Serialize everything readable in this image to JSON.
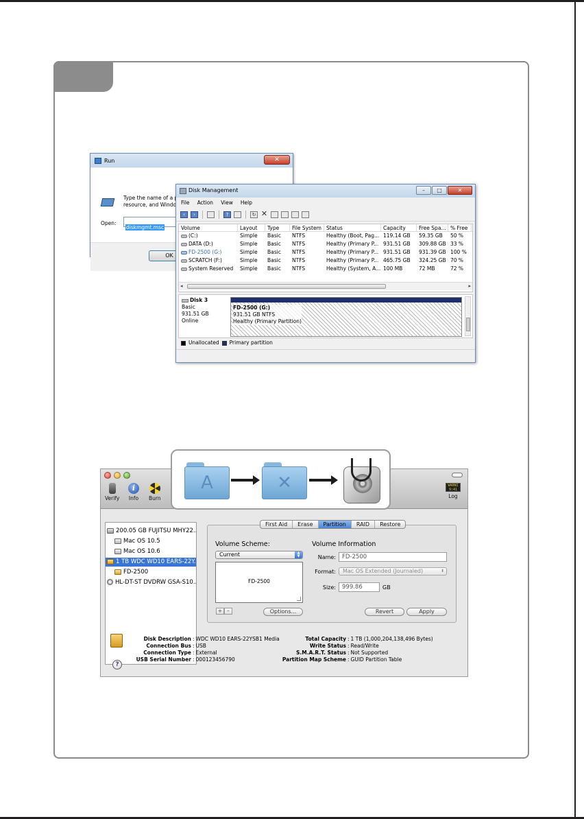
{
  "run_dialog": {
    "title": "Run",
    "description": "Type the name of a program, folder, document, or Internet resource, and Windows will open it for you.",
    "open_label": "Open:",
    "open_value": "diskmgmt.msc",
    "ok_label": "OK",
    "close_glyph": "✕"
  },
  "disk_management": {
    "title": "Disk Management",
    "window_buttons": {
      "minimize": "–",
      "maximize": "□",
      "close": "✕"
    },
    "menu": [
      "File",
      "Action",
      "View",
      "Help"
    ],
    "toolbar_icons": [
      "back-arrow-icon",
      "forward-arrow-icon",
      "console-tree-icon",
      "help-icon",
      "properties-icon",
      "refresh-icon",
      "delete-icon",
      "open-icon",
      "explore-icon",
      "search-icon",
      "settings-icon"
    ],
    "columns": [
      "Volume",
      "Layout",
      "Type",
      "File System",
      "Status",
      "Capacity",
      "Free Spa...",
      "% Free"
    ],
    "rows": [
      [
        "(C:)",
        "Simple",
        "Basic",
        "NTFS",
        "Healthy (Boot, Pag...",
        "119.14 GB",
        "59.35 GB",
        "50 %"
      ],
      [
        "DATA (D:)",
        "Simple",
        "Basic",
        "NTFS",
        "Healthy (Primary P...",
        "931.51 GB",
        "309.88 GB",
        "33 %"
      ],
      [
        "FD-2500 (G:)",
        "Simple",
        "Basic",
        "NTFS",
        "Healthy (Primary P...",
        "931.51 GB",
        "931.39 GB",
        "100 %"
      ],
      [
        "SCRATCH (F:)",
        "Simple",
        "Basic",
        "NTFS",
        "Healthy (Primary P...",
        "465.75 GB",
        "324.25 GB",
        "70 %"
      ],
      [
        "System Reserved",
        "Simple",
        "Basic",
        "NTFS",
        "Healthy (System, A...",
        "100 MB",
        "72 MB",
        "72 %"
      ]
    ],
    "disk": {
      "name": "Disk 3",
      "type": "Basic",
      "size": "931.51 GB",
      "state": "Online",
      "partition_name": "FD-2500  (G:)",
      "partition_size": "931.51 GB NTFS",
      "partition_status": "Healthy (Primary Partition)"
    },
    "legend": {
      "unallocated": "Unallocated",
      "primary": "Primary partition",
      "unallocated_color": "#000000",
      "primary_color": "#1f2f6b"
    }
  },
  "disk_utility": {
    "toolbar": {
      "verify": "Verify",
      "info": "Info",
      "burn": "Burn",
      "log": "Log",
      "info_glyph": "i",
      "log_glyph": "WARNI 9:41"
    },
    "sidebar": [
      "200.05 GB FUJITSU MHY22...",
      "Mac OS 10.5",
      "Mac OS 10.6",
      "1 TB WDC WD10 EARS-22Y...",
      "FD-2500",
      "HL-DT-ST DVDRW GSA-S10..."
    ],
    "tabs": [
      "First Aid",
      "Erase",
      "Partition",
      "RAID",
      "Restore"
    ],
    "active_tab": "Partition",
    "volume_scheme_label": "Volume Scheme:",
    "volume_scheme_value": "Current",
    "partition_box_label": "FD-2500",
    "add_glyph": "+",
    "remove_glyph": "–",
    "options_label": "Options...",
    "volume_info_label": "Volume Information",
    "name_label": "Name:",
    "name_value": "FD-2500",
    "format_label": "Format:",
    "format_value": "Mac OS Extended (Journaled)",
    "size_label": "Size:",
    "size_value": "999.86",
    "size_unit": "GB",
    "revert_label": "Revert",
    "apply_label": "Apply",
    "help_glyph": "?",
    "info_left": [
      {
        "k": "Disk Description",
        "v": "WDC WD10 EARS-22YSB1 Media"
      },
      {
        "k": "Connection Bus",
        "v": "USB"
      },
      {
        "k": "Connection Type",
        "v": "External"
      },
      {
        "k": "USB Serial Number",
        "v": "000123456790"
      }
    ],
    "info_right": [
      {
        "k": "Total Capacity",
        "v": "1 TB (1,000,204,138,496 Bytes)"
      },
      {
        "k": "Write Status",
        "v": "Read/Write"
      },
      {
        "k": "S.M.A.R.T. Status",
        "v": "Not Supported"
      },
      {
        "k": "Partition Map Scheme",
        "v": "GUID Partition Table"
      }
    ]
  },
  "icon_strip": {
    "icons": [
      "applications-folder-icon",
      "utilities-folder-icon",
      "disk-utility-icon"
    ],
    "applications_glyph": "A",
    "utilities_glyph": "✕"
  }
}
